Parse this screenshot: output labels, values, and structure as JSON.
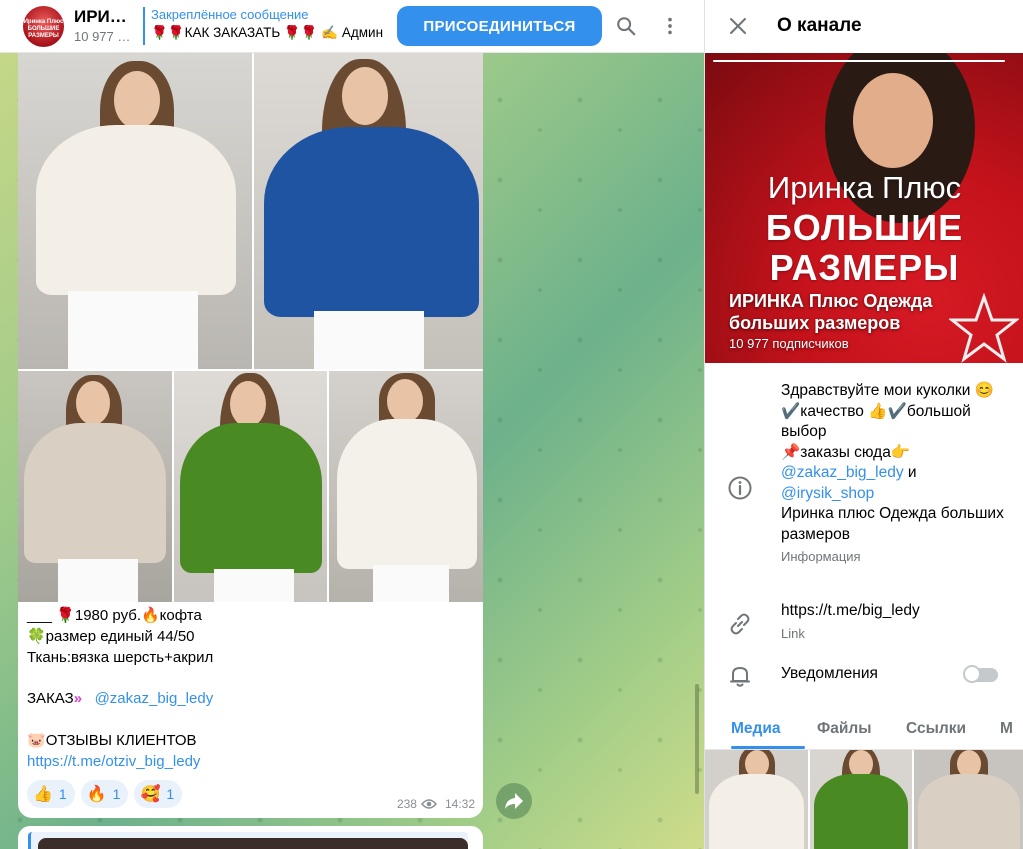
{
  "header": {
    "channel_title": "ИРИНКА Плюс Одежда больших размеров",
    "subscribers_short": "10 977 подписчиков",
    "avatar_text": "Иринка Плюс БОЛЬШИЕ РАЗМЕРЫ",
    "pinned_label": "Закреплённое сообщение",
    "pinned_text": "🌹🌹КАК ЗАКАЗАТЬ 🌹🌹 ✍️ Админ",
    "join_button": "ПРИСОЕДИНИТЬСЯ",
    "search_icon": "search-icon",
    "more_icon": "more-vertical-icon"
  },
  "message": {
    "caption_lines": [
      "___ 🌹1980 руб.🔥кофта",
      "🍀размер единый 44/50",
      "Ткань:вязка шерсть+акрил",
      "",
      "ЗАКАЗ",
      "",
      "ОТЗЫВЫ КЛИЕНТОВ"
    ],
    "order_arrows": "»",
    "order_link": "@zakaz_big_ledy",
    "reviews_icon": "🐷",
    "reviews_link": "https://t.me/otziv_big_ledy",
    "reactions": [
      {
        "emoji": "👍",
        "count": "1"
      },
      {
        "emoji": "🔥",
        "count": "1"
      },
      {
        "emoji": "🥰",
        "count": "1"
      }
    ],
    "views": "238",
    "time": "14:32",
    "photos": [
      {
        "sweater": "cream-white",
        "color": "#f3efe6"
      },
      {
        "sweater": "royal-blue",
        "color": "#1f54a3"
      },
      {
        "sweater": "beige",
        "color": "#d9cfc3"
      },
      {
        "sweater": "green",
        "color": "#4a8a22"
      },
      {
        "sweater": "milk-white",
        "color": "#f4f1ea"
      }
    ]
  },
  "panel": {
    "title": "О канале",
    "cover_brand": [
      "Иринка Плюс",
      "БОЛЬШИЕ",
      "РАЗМЕРЫ"
    ],
    "channel_name": "ИРИНКА Плюс Одежда больших размеров",
    "subscribers": "10 977 подписчиков",
    "description_lines": [
      "Здравствуйте мои куколки 😊",
      "✔️качество 👍✔️большой выбор",
      "📌заказы сюда👉"
    ],
    "desc_link1": "@zakaz_big_ledy",
    "desc_and": " и",
    "desc_link2": "@irysik_shop",
    "desc_tail": "Иринка плюс Одежда больших размеров",
    "info_label": "Информация",
    "link_value": "https://t.me/big_ledy",
    "link_label": "Link",
    "notifications_label": "Уведомления",
    "notifications_on": false,
    "tabs": [
      "Медиа",
      "Файлы",
      "Ссылки",
      "М"
    ],
    "active_tab": "Медиа"
  },
  "colors": {
    "accent": "#3390ec",
    "secondary_text": "#707579"
  }
}
